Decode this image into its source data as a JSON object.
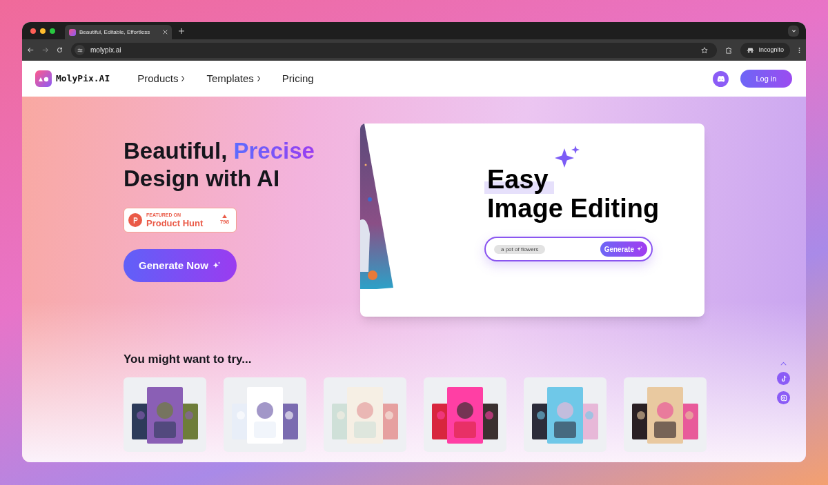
{
  "browser": {
    "tab_title": "Beautiful, Editable, Effortless",
    "url": "molypix.ai",
    "profile": "Incognito"
  },
  "nav": {
    "logo": "MolyPix.AI",
    "items": [
      {
        "label": "Products",
        "has_submenu": true
      },
      {
        "label": "Templates",
        "has_submenu": true
      },
      {
        "label": "Pricing",
        "has_submenu": false
      }
    ],
    "login": "Log in"
  },
  "hero": {
    "title_start": "Beautiful, ",
    "title_highlight": "Precise",
    "title_end": "Design with AI",
    "badge": {
      "eyebrow": "FEATURED ON",
      "name": "Product Hunt",
      "votes": "798"
    },
    "cta": "Generate Now"
  },
  "demo": {
    "line_1": "Easy",
    "line_2": "Image Editing",
    "prompt": "a pot of flowers",
    "button": "Generate"
  },
  "suggestions": {
    "title": "You might want to try..."
  }
}
